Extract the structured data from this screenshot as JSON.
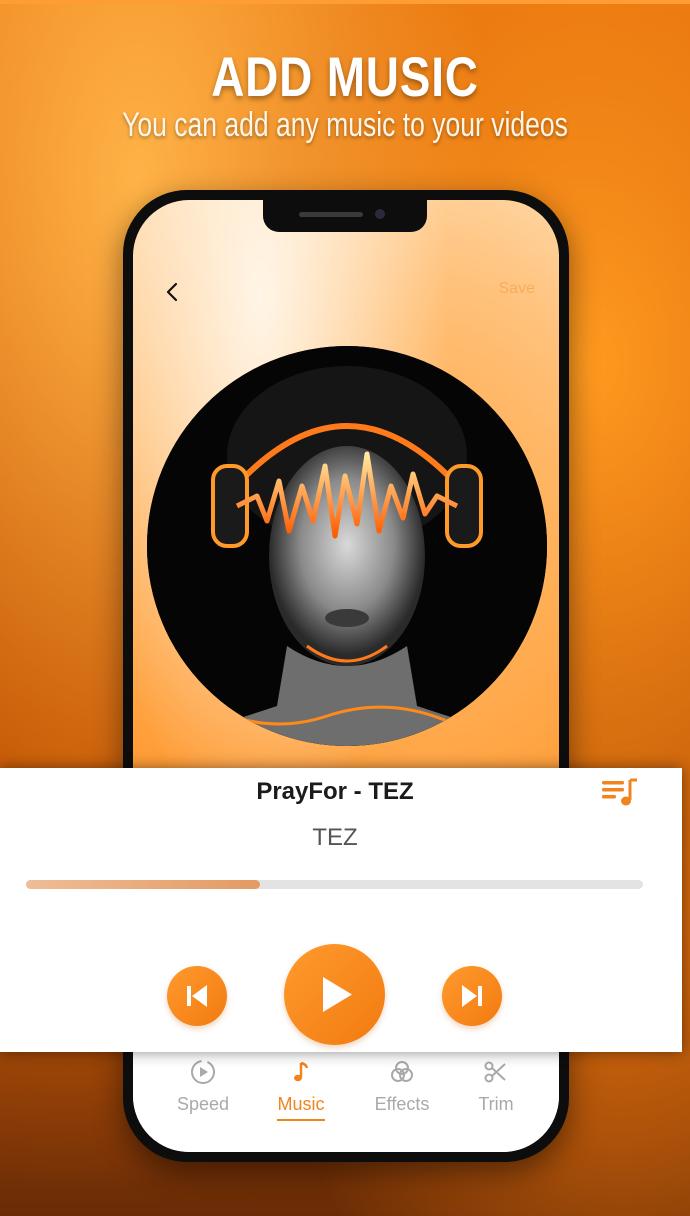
{
  "hero": {
    "title": "ADD MUSIC",
    "subtitle": "You can add any music to your videos"
  },
  "editor": {
    "save_label": "Save"
  },
  "player": {
    "song_title": "PrayFor - TEZ",
    "artist": "TEZ",
    "progress": 0.38
  },
  "nav": {
    "items": [
      {
        "label": "Speed",
        "icon": "speed-icon",
        "active": false
      },
      {
        "label": "Music",
        "icon": "music-note-icon",
        "active": true
      },
      {
        "label": "Effects",
        "icon": "effects-icon",
        "active": false
      },
      {
        "label": "Trim",
        "icon": "scissors-icon",
        "active": false
      }
    ]
  },
  "colors": {
    "accent": "#f2841e",
    "inactive": "#a9a9a9"
  }
}
